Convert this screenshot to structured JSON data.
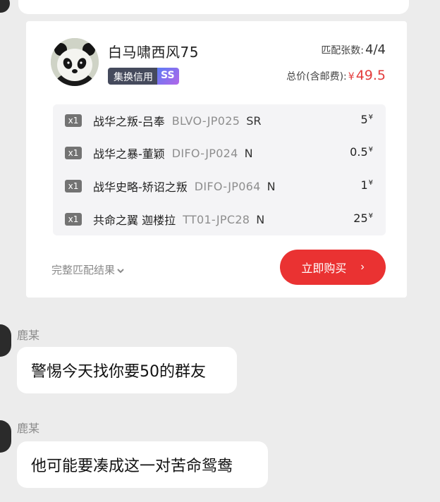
{
  "seller": {
    "name": "白马啸西风75",
    "credit_label": "集换信用",
    "credit_level": "SS"
  },
  "summary": {
    "match_label": "匹配张数:",
    "match_value": "4/4",
    "total_label": "总价(含邮费):",
    "total_currency": "¥",
    "total_value": "49.5"
  },
  "items": [
    {
      "qty": "x1",
      "name": "战华之叛-吕奉",
      "code": "BLVO-JP025",
      "rarity": "SR",
      "price": "5",
      "currency": "¥"
    },
    {
      "qty": "x1",
      "name": "战华之暴-董颖",
      "code": "DIFO-JP024",
      "rarity": "N",
      "price": "0.5",
      "currency": "¥"
    },
    {
      "qty": "x1",
      "name": "战华史略-矫诏之叛",
      "code": "DIFO-JP064",
      "rarity": "N",
      "price": "1",
      "currency": "¥"
    },
    {
      "qty": "x1",
      "name": "共命之翼 迦楼拉",
      "code": "TT01-JPC28",
      "rarity": "N",
      "price": "25",
      "currency": "¥"
    }
  ],
  "actions": {
    "full_result_label": "完整匹配结果",
    "buy_label": "立即购买"
  },
  "messages": [
    {
      "sender": "鹿某",
      "text": "警惕今天找你要50的群友"
    },
    {
      "sender": "鹿某",
      "text": "他可能要凑成这一对苦命鸳鸯"
    }
  ],
  "colors": {
    "accent_red": "#ea3232",
    "price_red": "#e33b3b",
    "badge_dark": "#454a5c"
  }
}
